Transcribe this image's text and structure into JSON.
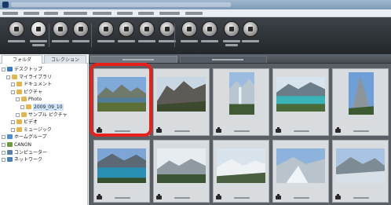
{
  "app": {
    "window_title": "",
    "accent_color": "#e8201a"
  },
  "menu": {
    "items": []
  },
  "toolbar": {
    "buttons": [
      {
        "icon": "folder-browse-icon"
      },
      {
        "icon": "browser-view-icon",
        "active": true
      },
      {
        "icon": "layout-icon"
      },
      {
        "icon": "info-icon"
      },
      {
        "icon": "print-icon"
      },
      {
        "icon": "email-icon"
      },
      {
        "icon": "rotate-left-icon"
      },
      {
        "icon": "rotate-right-icon"
      },
      {
        "icon": "slideshow-icon"
      },
      {
        "icon": "compare-icon"
      },
      {
        "icon": "preview-icon"
      },
      {
        "icon": "batch-icon"
      }
    ]
  },
  "left_panel": {
    "tabs": [
      {
        "label": "フォルダ",
        "selected": true
      },
      {
        "label": "コレクション",
        "selected": false
      }
    ],
    "tree": [
      {
        "label": "デスクトップ",
        "level": 0,
        "icon": "desktop-icon",
        "color": "#3b79c7"
      },
      {
        "label": "マイライブラリ",
        "level": 1,
        "icon": "library-icon",
        "color": "#e4b54a"
      },
      {
        "label": "ドキュメント",
        "level": 2,
        "icon": "folder-icon",
        "color": "#e4b54a"
      },
      {
        "label": "ピクチャ",
        "level": 2,
        "icon": "folder-icon",
        "color": "#e4b54a"
      },
      {
        "label": "Photo",
        "level": 3,
        "icon": "folder-icon",
        "color": "#e4b54a"
      },
      {
        "label": "2009_09_10",
        "level": 4,
        "icon": "folder-icon",
        "color": "#e4b54a",
        "selected": true
      },
      {
        "label": "サンプル ピクチャ",
        "level": 3,
        "icon": "folder-icon",
        "color": "#e4b54a"
      },
      {
        "label": "ビデオ",
        "level": 2,
        "icon": "folder-icon",
        "color": "#e4b54a"
      },
      {
        "label": "ミュージック",
        "level": 2,
        "icon": "folder-icon",
        "color": "#e4b54a"
      },
      {
        "label": "ホームグループ",
        "level": 0,
        "icon": "homegroup-icon",
        "color": "#4a8fd6"
      },
      {
        "label": "CANON",
        "level": 0,
        "icon": "user-icon",
        "color": "#6a9a3a"
      },
      {
        "label": "コンピューター",
        "level": 0,
        "icon": "computer-icon",
        "color": "#5a7fa8"
      },
      {
        "label": "ネットワーク",
        "level": 0,
        "icon": "network-icon",
        "color": "#4a7fb8"
      }
    ]
  },
  "grid": {
    "thumbnails": [
      {
        "scene": "lake-mountain",
        "orientation": "landscape",
        "selected": true
      },
      {
        "scene": "rocky-mountain",
        "orientation": "landscape"
      },
      {
        "scene": "waterfall",
        "orientation": "portrait"
      },
      {
        "scene": "turquoise-lake",
        "orientation": "landscape"
      },
      {
        "scene": "tall-peak",
        "orientation": "portrait"
      },
      {
        "scene": "blue-lake",
        "orientation": "landscape"
      },
      {
        "scene": "cloud-peaks",
        "orientation": "landscape"
      },
      {
        "scene": "snow-valley",
        "orientation": "landscape"
      },
      {
        "scene": "glacier",
        "orientation": "landscape"
      },
      {
        "scene": "glacier-2",
        "orientation": "landscape"
      }
    ]
  }
}
